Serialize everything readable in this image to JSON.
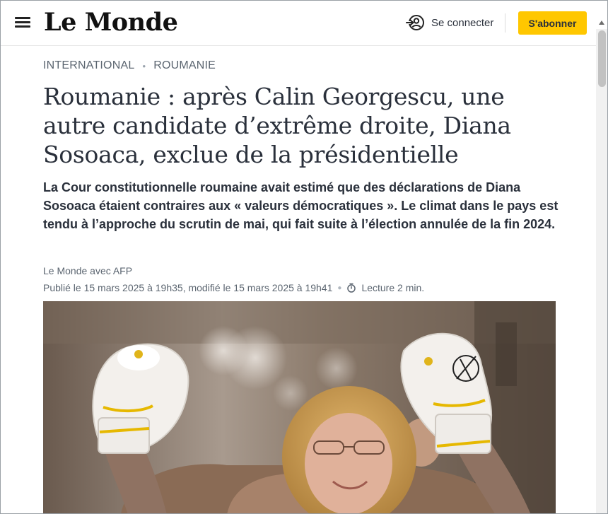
{
  "header": {
    "logo": "Le Monde",
    "login_label": "Se connecter",
    "subscribe_label": "S'abonner"
  },
  "breadcrumb": [
    "INTERNATIONAL",
    "ROUMANIE"
  ],
  "article": {
    "title": "Roumanie : après Calin Georgescu, une autre candidate d’extrême droite, Diana Sosoaca, exclue de la présidentielle",
    "lede": "La Cour constitutionnelle roumaine avait estimé que des déclarations de Diana Sosoaca étaient contraires aux « valeurs démocratiques ». Le climat dans le pays est tendu à l’approche du scrutin de mai, qui fait suite à l’élection annulée de la fin 2024.",
    "author": "Le Monde avec AFP",
    "dates": "Publié le 15 mars 2025 à 19h35, modifié le 15 mars 2025 à 19h41",
    "reading_time": "Lecture 2 min."
  },
  "colors": {
    "subscribe_accent": "#ffc700",
    "text": "#2a303b",
    "meta": "#5b6570"
  },
  "icons": {
    "menu": "hamburger-icon",
    "login": "user-login-icon",
    "reading_time": "stopwatch-icon"
  }
}
